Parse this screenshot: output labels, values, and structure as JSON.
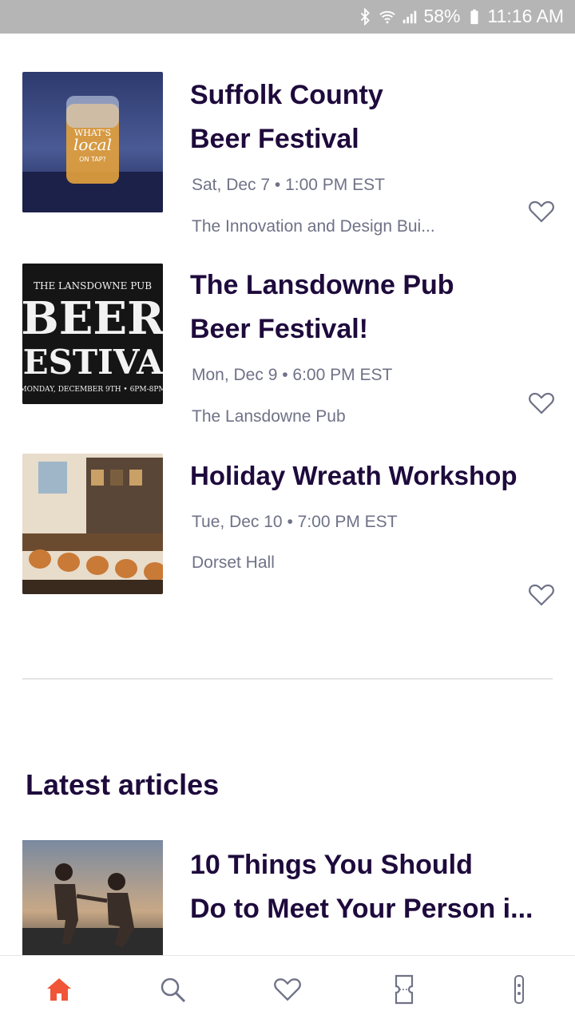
{
  "status_bar": {
    "battery": "58%",
    "time": "11:16 AM",
    "icons": [
      "bluetooth-icon",
      "wifi-icon",
      "signal-icon",
      "battery-icon"
    ]
  },
  "events": [
    {
      "title_line1": "Suffolk County",
      "title_line2": "Beer Festival",
      "date": "Sat, Dec 7 • 1:00 PM EST",
      "venue": "The Innovation and Design Bui...",
      "image": "beer-glass-photo"
    },
    {
      "title_line1": "The Lansdowne Pub",
      "title_line2": "Beer Festival!",
      "date": "Mon, Dec 9 • 6:00 PM EST",
      "venue": "The Lansdowne Pub",
      "image": "beer-festival-poster"
    },
    {
      "title_line1": "Holiday Wreath Workshop",
      "title_line2": "",
      "date": "Tue, Dec 10 • 7:00 PM EST",
      "venue": "Dorset Hall",
      "image": "bar-interior-photo"
    }
  ],
  "section": {
    "title": "Latest articles"
  },
  "articles": [
    {
      "title_line1": "10 Things You Should",
      "title_line2": "Do to Meet Your Person i...",
      "image": "couple-running-photo"
    }
  ],
  "bottom_nav": [
    "home-icon",
    "search-icon",
    "heart-icon",
    "ticket-icon",
    "profile-icon"
  ],
  "colors": {
    "title": "#1e0a3c",
    "meta": "#6f7287",
    "accent": "#f05537",
    "status_bar": "#b5b5b5"
  }
}
